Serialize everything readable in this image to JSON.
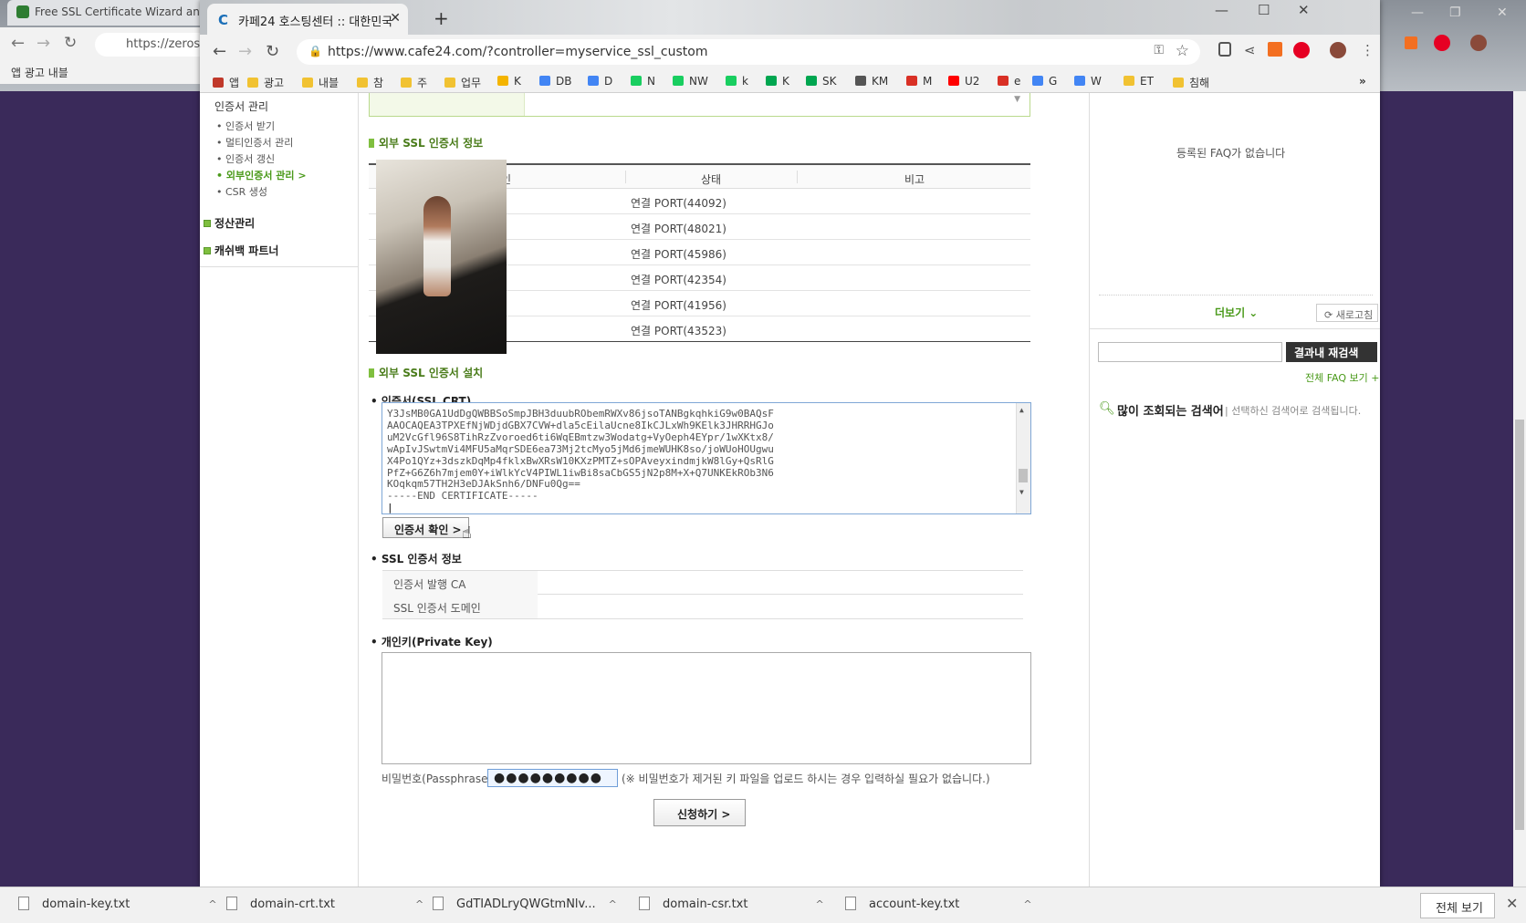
{
  "bg_window": {
    "tab_title": "Free SSL Certificate Wizard and",
    "url": "https://zeros",
    "bookmarks": "앱   광고   내블"
  },
  "window": {
    "tab_title": "카페24 호스팅센터 :: 대한민국",
    "url": "https://www.cafe24.com/?controller=myservice_ssl_custom",
    "min_icon": "—",
    "max_icon": "☐",
    "close_icon": "✕"
  },
  "bookmarks": [
    {
      "label": "앱",
      "color": "#c0392b"
    },
    {
      "label": "광고",
      "color": "#f1c232"
    },
    {
      "label": "내블",
      "color": "#f1c232"
    },
    {
      "label": "참",
      "color": "#f1c232"
    },
    {
      "label": "주",
      "color": "#f1c232"
    },
    {
      "label": "업무",
      "color": "#f1c232"
    },
    {
      "label": "K",
      "color": "#f4b400"
    },
    {
      "label": "DB",
      "color": "#4285f4"
    },
    {
      "label": "D",
      "color": "#4285f4"
    },
    {
      "label": "N",
      "color": "#19ce60"
    },
    {
      "label": "NW",
      "color": "#19ce60"
    },
    {
      "label": "k",
      "color": "#19ce60"
    },
    {
      "label": "K",
      "color": "#00a650"
    },
    {
      "label": "SK",
      "color": "#00a650"
    },
    {
      "label": "KM",
      "color": "#555555"
    },
    {
      "label": "M",
      "color": "#d93025"
    },
    {
      "label": "U2",
      "color": "#ff0000"
    },
    {
      "label": "e",
      "color": "#d93025"
    },
    {
      "label": "G",
      "color": "#4285f4"
    },
    {
      "label": "W",
      "color": "#4285f4"
    },
    {
      "label": "ET",
      "color": "#f1c232"
    },
    {
      "label": "침해",
      "color": "#f1c232"
    }
  ],
  "leftnav": {
    "group_title": "인증서 관리",
    "items": [
      "인증서 받기",
      "멀티인증서 관리",
      "인증서 갱신",
      "외부인증서 관리 >",
      "CSR 생성"
    ],
    "sections": [
      "정산관리",
      "캐쉬백 파트너"
    ]
  },
  "main": {
    "ext_info_title": "외부 SSL 인증서 정보",
    "table": {
      "headers": [
        "인",
        "상태",
        "비고"
      ],
      "rows": [
        "연결 PORT(44092)",
        "연결 PORT(48021)",
        "연결 PORT(45986)",
        "연결 PORT(42354)",
        "연결 PORT(41956)",
        "연결 PORT(43523)"
      ]
    },
    "install_title": "외부 SSL 인증서 설치",
    "crt_label": "• 인증서(SSL CRT)",
    "crt_lines": [
      "Y3JsMB0GA1UdDgQWBBSoSmpJBH3duubRObemRWXv86jsoTANBgkqhkiG9w0BAQsF",
      "AAOCAQEA3TPXEfNjWDjdGBX7CVW+dla5cEilaUcne8IkCJLxWh9KElk3JHRRHGJo",
      "uM2VcGfl96S8TihRzZvoroed6ti6WqEBmtzw3Wodatg+VyOeph4EYpr/1wXKtx8/",
      "wApIvJSwtmVi4MFU5aMqrSDE6ea73Mj2tcMyo5jMd6jmeWUHK8so/joWUoHOUgwu",
      "X4Po1QYz+3dszkDqMp4fklxBwXRsW10KXzPMTZ+sOPAveyxindmjkW8lGy+QsRlG",
      "PfZ+G6Z6h7mjem0Y+iWlkYcV4PIWL1iwBi8saCbGS5jN2p8M+X+Q7UNKEkROb3N6",
      "KOqkqm57TH2H3eDJAkSnh6/DNFu0Qg==",
      "-----END CERTIFICATE-----"
    ],
    "crt_button": "인증서 확인 >",
    "ssl_info_label": "• SSL 인증서 정보",
    "ssl_info_rows": [
      "인증서 발행 CA",
      "SSL 인증서 도메인"
    ],
    "pk_label": "• 개인키(Private Key)",
    "passphrase_label": "비밀번호(Passphrase)",
    "passphrase_value": "●●●●●●●●●",
    "passphrase_note": "(※ 비밀번호가 제거된 키 파일을 업로드 하시는 경우 입력하실 필요가 없습니다.)",
    "submit_button": "신청하기 >"
  },
  "right": {
    "no_faq": "등록된 FAQ가 없습니다",
    "more": "더보기 ⌄",
    "refresh": "⟳ 새로고침",
    "research_button": "결과내 재검색",
    "all_faq": "전체 FAQ 보기 +",
    "popular_title": "많이 조회되는 검색어",
    "popular_hint": "선택하신 검색어로 검색됩니다."
  },
  "downloads": {
    "items": [
      "domain-key.txt",
      "domain-crt.txt",
      "GdTIADLryQWGtmNlv...",
      "domain-csr.txt",
      "account-key.txt"
    ],
    "show_all": "전체 보기"
  }
}
